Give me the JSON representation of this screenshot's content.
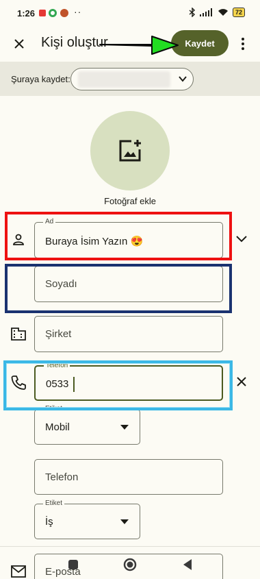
{
  "status_bar": {
    "time": "1:26",
    "dots": "··",
    "battery": "72",
    "colors": {
      "notif1": "#e53935",
      "notif2": "#33a852",
      "notif3": "#c0532a"
    }
  },
  "app_bar": {
    "title": "Kişi oluştur",
    "save_label": "Kaydet",
    "close_icon": "close-icon",
    "more_icon": "more-vert-icon"
  },
  "account": {
    "label": "Şuraya kaydet:",
    "icon": "chevron-down-icon"
  },
  "photo": {
    "label": "Fotoğraf ekle",
    "icon": "add-photo-icon"
  },
  "form": {
    "first_name": {
      "label": "Ad",
      "value": "Buraya İsim Yazın 😍"
    },
    "last_name": {
      "placeholder": "Soyadı"
    },
    "company": {
      "placeholder": "Şirket"
    },
    "phone": {
      "label": "Telefon",
      "value": "0533"
    },
    "phone_type": {
      "label": "Etiket",
      "value": "Mobil"
    },
    "phone2": {
      "placeholder": "Telefon"
    },
    "phone2_type": {
      "label": "Etiket",
      "value": "İş"
    },
    "email": {
      "placeholder": "E-posta"
    }
  },
  "colors": {
    "accent": "#55622a",
    "background": "#fcfbf4",
    "account_bar": "#e9e8dd",
    "photo_bg": "#d8e0c0",
    "annotation_red": "#ee1111",
    "annotation_navy": "#1a3270",
    "annotation_cyan": "#3bb8e6",
    "annotation_arrow": "#22dd22"
  }
}
